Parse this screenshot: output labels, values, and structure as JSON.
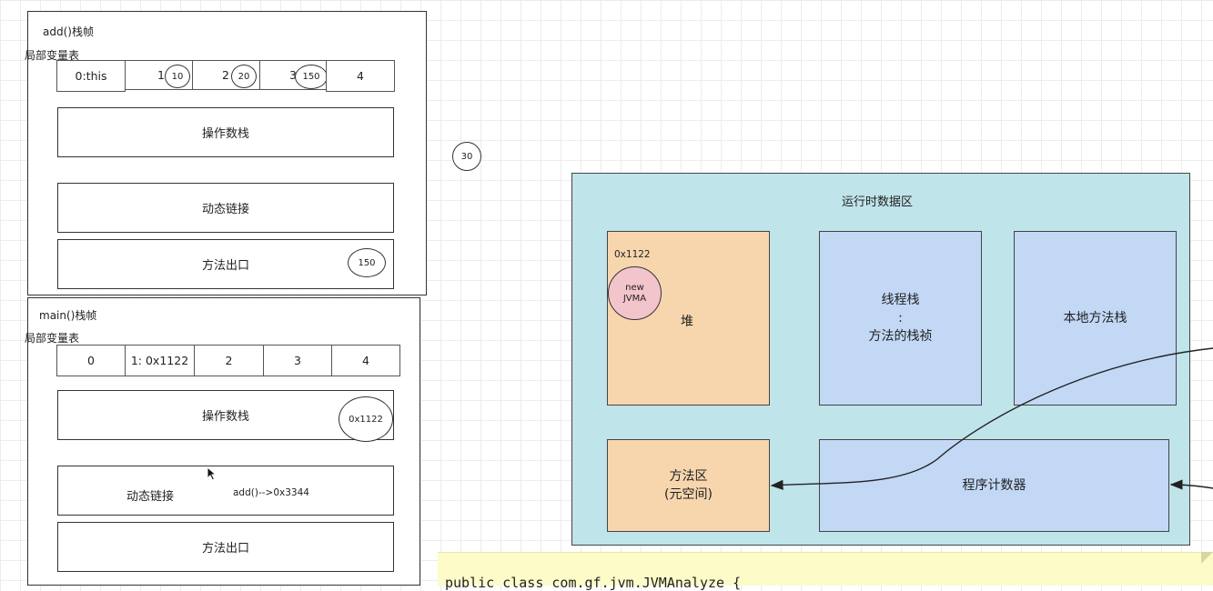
{
  "add_frame": {
    "title": "add()栈帧",
    "locals_label": "局部变量表",
    "locals": [
      {
        "label": "0:this"
      },
      {
        "label": "1",
        "value": "10"
      },
      {
        "label": "2",
        "value": "20"
      },
      {
        "label": "3",
        "value": "150"
      },
      {
        "label": "4"
      }
    ],
    "operand_stack": "操作数栈",
    "dynamic_link": "动态链接",
    "return_addr": "方法出口",
    "return_value": "150"
  },
  "main_frame": {
    "title": "main()栈帧",
    "locals_label": "局部变量表",
    "locals": [
      {
        "label": "0"
      },
      {
        "label": "1:  0x1122"
      },
      {
        "label": "2"
      },
      {
        "label": "3"
      },
      {
        "label": "4"
      }
    ],
    "operand_stack": "操作数栈",
    "operand_value": "0x1122",
    "dynamic_link": "动态链接",
    "dynamic_link_value": "add()-->0x3344",
    "return_addr": "方法出口"
  },
  "floating_value": "30",
  "runtime_area": {
    "title": "运行时数据区",
    "heap": {
      "address": "0x1122",
      "object_line1": "new",
      "object_line2": "JVMA",
      "label": "堆"
    },
    "thread_stack": {
      "line1": "线程栈",
      "line2": ":",
      "line3": "方法的栈祯"
    },
    "native_stack": "本地方法栈",
    "method_area": {
      "line1": "方法区",
      "line2": "(元空间)"
    },
    "pc_register": "程序计数器"
  },
  "code_note": "public class com.gf.jvm.JVMAnalyze {",
  "colors": {
    "runtime_bg": "#bfe4ea",
    "heap_bg": "#f7d6ae",
    "blue_bg": "#c2d8f5",
    "object_bg": "#f2c4cc",
    "note_bg": "#fdfbc8"
  }
}
